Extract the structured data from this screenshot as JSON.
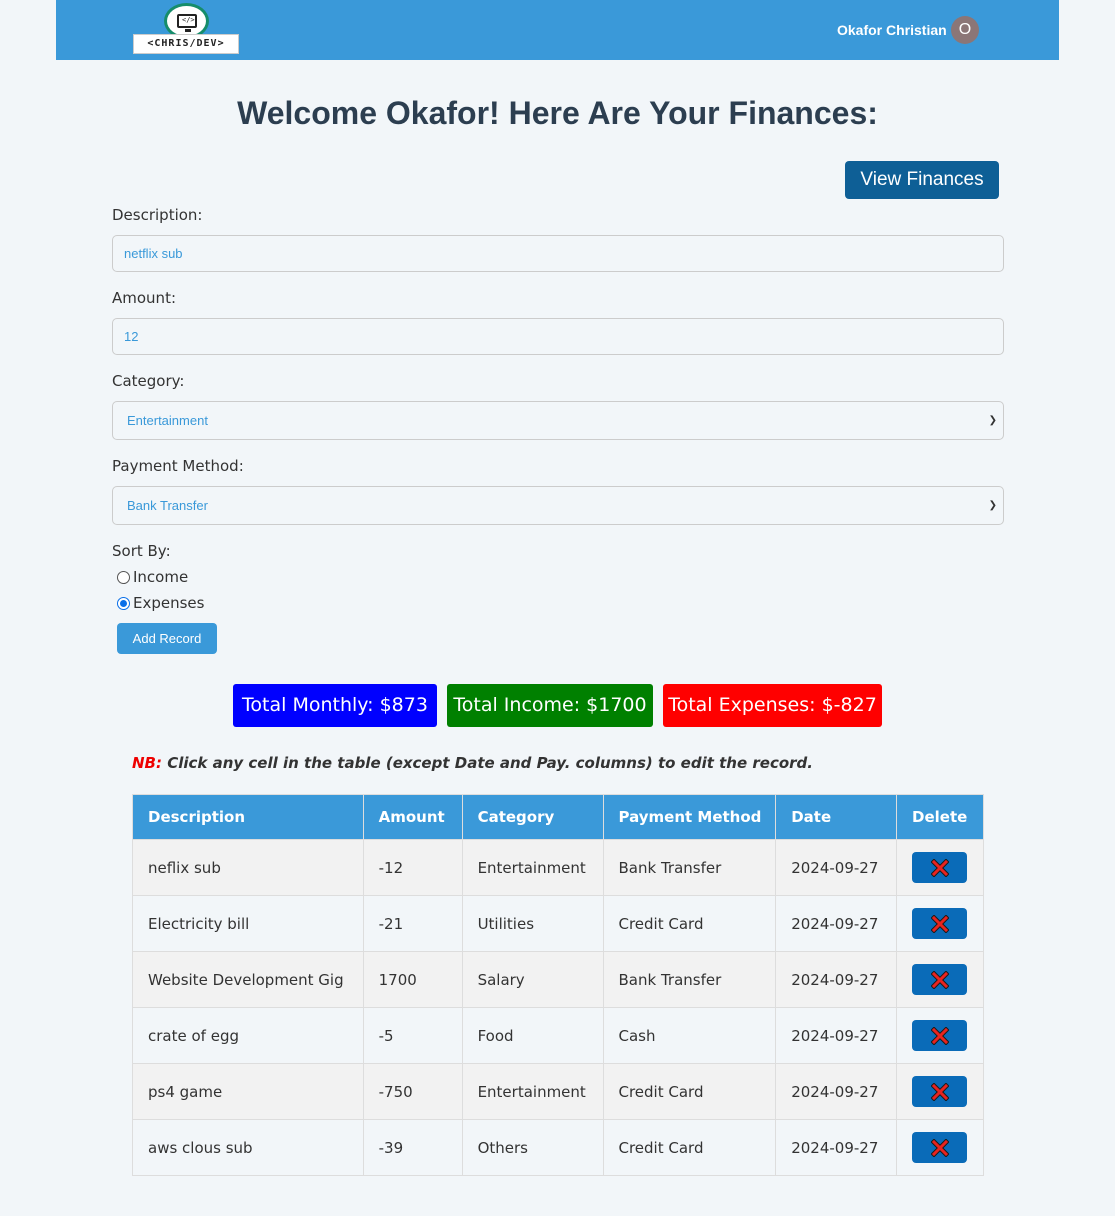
{
  "navbar": {
    "logo_text": "<CHRIS/DEV>",
    "logo_icon_code": "</>",
    "user_name": "Okafor Christian",
    "avatar_initial": "O"
  },
  "page_title": "Welcome Okafor! Here Are Your Finances:",
  "view_finances_label": "View Finances",
  "form": {
    "description": {
      "label": "Description:",
      "value": "netflix sub"
    },
    "amount": {
      "label": "Amount:",
      "value": "12"
    },
    "category": {
      "label": "Category:",
      "value": "Entertainment"
    },
    "payment_method": {
      "label": "Payment Method:",
      "value": "Bank Transfer"
    },
    "sort_by": {
      "label": "Sort By:",
      "options": [
        {
          "label": "Income",
          "selected": false
        },
        {
          "label": "Expenses",
          "selected": true
        }
      ]
    },
    "submit_label": "Add Record"
  },
  "totals": {
    "monthly": "Total Monthly: $873",
    "income": "Total Income: $1700",
    "expenses": "Total Expenses: $-827"
  },
  "note": {
    "tag": "NB:",
    "text": "Click any cell in the table (except Date and Pay. columns) to edit the record."
  },
  "table": {
    "headers": [
      "Description",
      "Amount",
      "Category",
      "Payment Method",
      "Date",
      "Delete"
    ],
    "rows": [
      [
        "neflix sub",
        "-12",
        "Entertainment",
        "Bank Transfer",
        "2024-09-27"
      ],
      [
        "Electricity bill",
        "-21",
        "Utilities",
        "Credit Card",
        "2024-09-27"
      ],
      [
        "Website Development Gig",
        "1700",
        "Salary",
        "Bank Transfer",
        "2024-09-27"
      ],
      [
        "crate of egg",
        "-5",
        "Food",
        "Cash",
        "2024-09-27"
      ],
      [
        "ps4 game",
        "-750",
        "Entertainment",
        "Credit Card",
        "2024-09-27"
      ],
      [
        "aws clous sub",
        "-39",
        "Others",
        "Credit Card",
        "2024-09-27"
      ]
    ],
    "delete_icon": "red-x-icon"
  },
  "colors": {
    "navbar": "#3a99d9",
    "primary_button": "#0e5f96",
    "total_monthly": "#0000ff",
    "total_income": "#008000",
    "total_expenses": "#ff0000"
  }
}
